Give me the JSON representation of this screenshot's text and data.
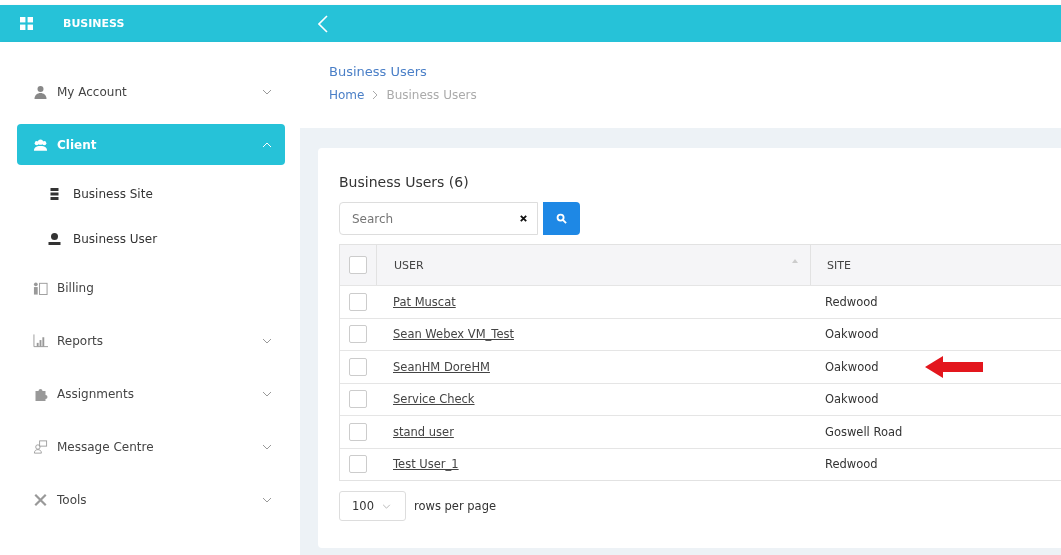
{
  "app": {
    "title": "BUSINESS"
  },
  "sidebar": {
    "items": [
      {
        "label": "My Account",
        "has_children": true,
        "expanded": false,
        "selected": false
      },
      {
        "label": "Client",
        "has_children": true,
        "expanded": true,
        "selected": true,
        "children": [
          {
            "label": "Business Site"
          },
          {
            "label": "Business User"
          }
        ]
      },
      {
        "label": "Billing",
        "has_children": false,
        "selected": false
      },
      {
        "label": "Reports",
        "has_children": true,
        "expanded": false,
        "selected": false
      },
      {
        "label": "Assignments",
        "has_children": true,
        "expanded": false,
        "selected": false
      },
      {
        "label": "Message Centre",
        "has_children": true,
        "expanded": false,
        "selected": false
      },
      {
        "label": "Tools",
        "has_children": true,
        "expanded": false,
        "selected": false
      }
    ]
  },
  "page": {
    "title": "Business Users",
    "breadcrumb": [
      "Home",
      "Business Users"
    ]
  },
  "card": {
    "title": "Business Users (6)",
    "search": {
      "placeholder": "Search"
    },
    "table": {
      "all_checked": false,
      "columns": [
        {
          "label": "USER",
          "sortable": true
        },
        {
          "label": "SITE",
          "sortable": false
        }
      ],
      "rows": [
        {
          "user": "Pat Muscat",
          "site": "Redwood",
          "checked": false,
          "pointed": false
        },
        {
          "user": "Sean Webex VM_Test",
          "site": "Oakwood",
          "checked": false,
          "pointed": false
        },
        {
          "user": "SeanHM DoreHM",
          "site": "Oakwood",
          "checked": false,
          "pointed": true
        },
        {
          "user": "Service Check",
          "site": "Oakwood",
          "checked": false,
          "pointed": false
        },
        {
          "user": "stand user",
          "site": "Goswell Road",
          "checked": false,
          "pointed": false
        },
        {
          "user": "Test User_1",
          "site": "Redwood",
          "checked": false,
          "pointed": false
        }
      ]
    },
    "pager": {
      "page_size": "100",
      "label": "rows per page"
    }
  }
}
